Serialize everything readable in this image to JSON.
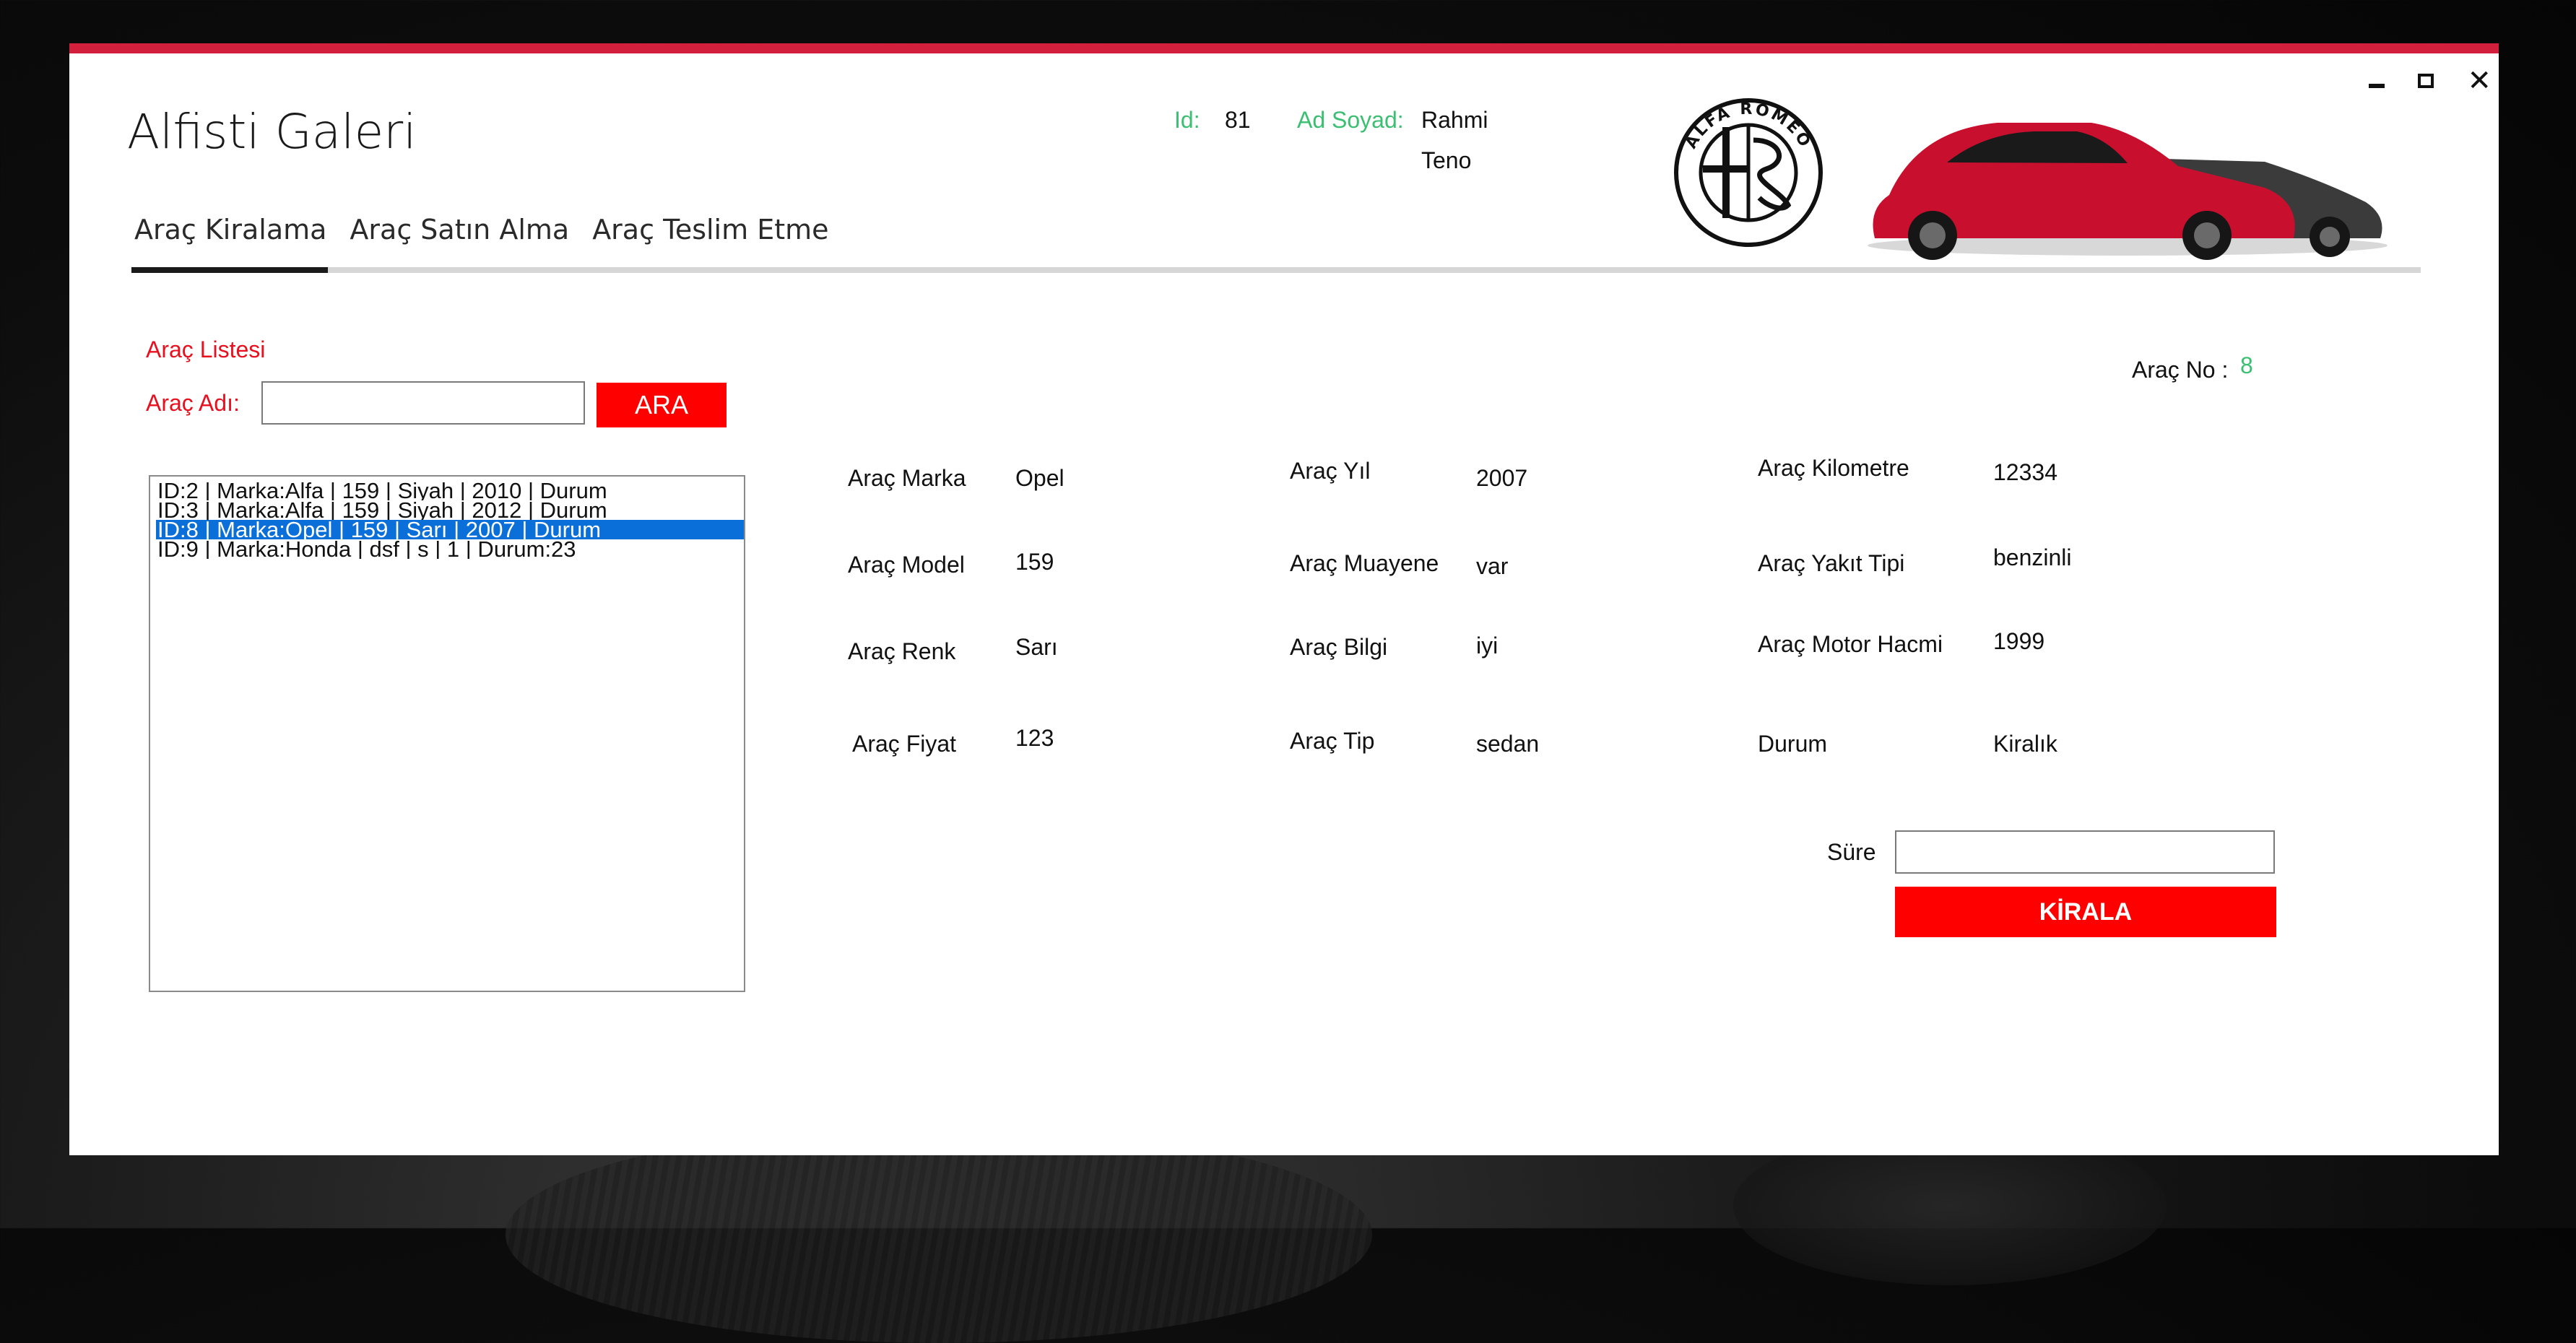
{
  "window": {
    "title": "Alfisti Galeri",
    "controls": {
      "minimize": "minimize-icon",
      "maximize": "maximize-icon",
      "close": "close-icon"
    },
    "accent_color": "#d21f3c"
  },
  "tabs": [
    {
      "label": "Araç Kiralama",
      "active": true
    },
    {
      "label": "Araç Satın Alma",
      "active": false
    },
    {
      "label": "Araç Teslim Etme",
      "active": false
    }
  ],
  "user": {
    "id_label": "Id:",
    "id_value": "81",
    "name_label": "Ad Soyad:",
    "first_name": "Rahmi",
    "last_name": "Teno"
  },
  "logo": {
    "text": "ALFA ROMEO"
  },
  "list_section": {
    "title": "Araç Listesi",
    "search_label": "Araç Adı:",
    "search_value": "",
    "search_button": "ARA",
    "items": [
      {
        "text": "ID:2 | Marka:Alfa   |   159   |   Siyah   |   2010  |  Durum",
        "selected": false
      },
      {
        "text": "ID:3 | Marka:Alfa   |   159   |   Siyah   |   2012  |  Durum",
        "selected": false
      },
      {
        "text": "ID:8 | Marka:Opel   |   159   |   Sarı   |   2007  |  Durum",
        "selected": true
      },
      {
        "text": "ID:9 | Marka:Honda   |   dsf   |   s   |   1  |  Durum:23",
        "selected": false
      }
    ]
  },
  "vehicle_no": {
    "label": "Araç No :",
    "value": "8"
  },
  "details": {
    "col1": [
      {
        "label": "Araç Marka",
        "value": "Opel"
      },
      {
        "label": "Araç Model",
        "value": "159"
      },
      {
        "label": "Araç Renk",
        "value": "Sarı"
      },
      {
        "label": "Araç Fiyat",
        "value": "123"
      }
    ],
    "col2": [
      {
        "label": "Araç Yıl",
        "value": "2007"
      },
      {
        "label": "Araç Muayene",
        "value": "var"
      },
      {
        "label": "Araç Bilgi",
        "value": "iyi"
      },
      {
        "label": "Araç Tip",
        "value": "sedan"
      }
    ],
    "col3": [
      {
        "label": "Araç Kilometre",
        "value": "12334"
      },
      {
        "label": "Araç Yakıt Tipi",
        "value": "benzinli"
      },
      {
        "label": "Araç Motor Hacmi",
        "value": "1999"
      },
      {
        "label": "Durum",
        "value": "Kiralık"
      }
    ]
  },
  "rent": {
    "duration_label": "Süre",
    "duration_value": "",
    "button": "KİRALA"
  },
  "colors": {
    "accent_red": "#ff0000",
    "label_red": "#e8101e",
    "label_green": "#3bbf72",
    "selection_blue": "#0a6fd8"
  }
}
